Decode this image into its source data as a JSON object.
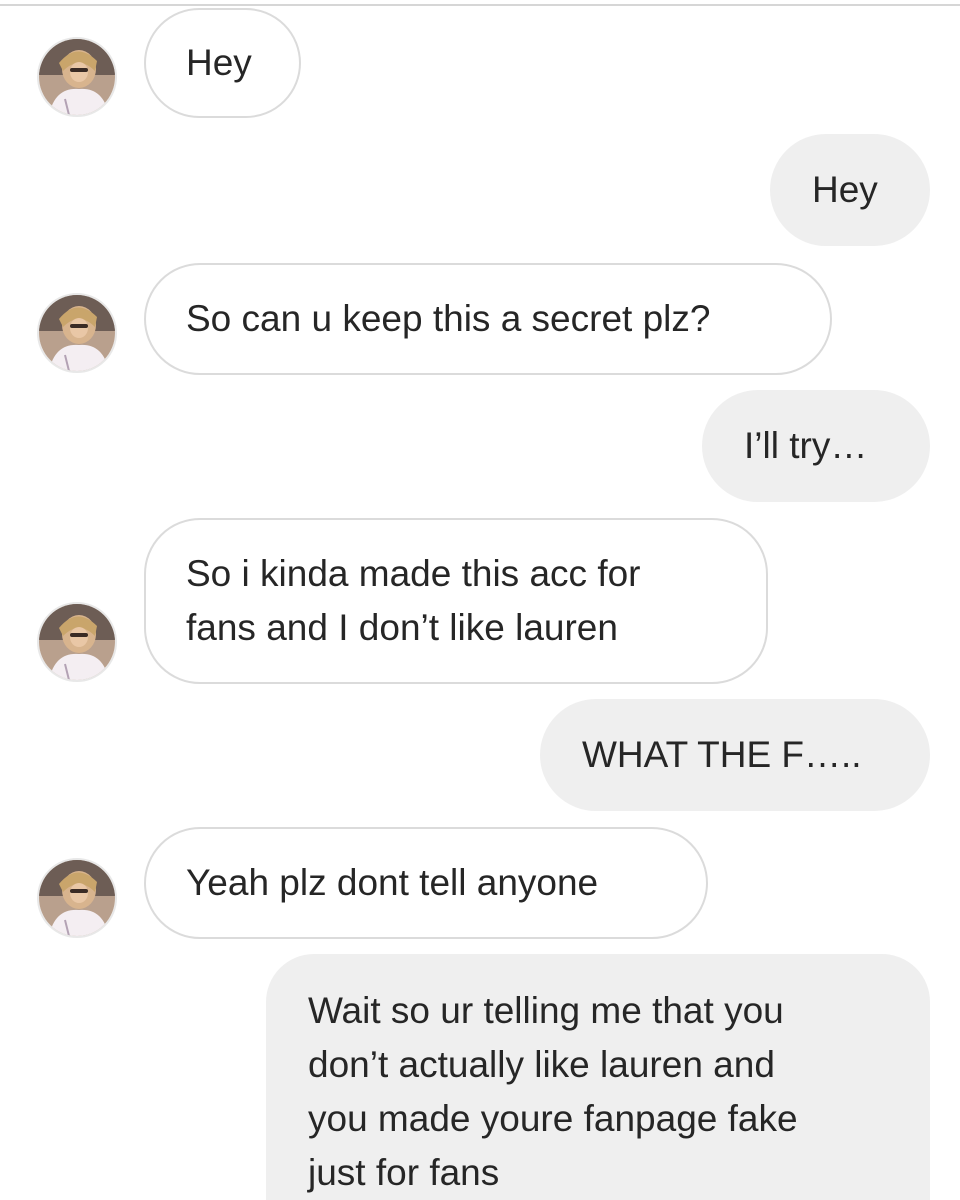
{
  "thread": {
    "messages": [
      {
        "sender": "them",
        "text": "Hey"
      },
      {
        "sender": "me",
        "text": "Hey"
      },
      {
        "sender": "them",
        "text": "So can u keep this a secret plz?"
      },
      {
        "sender": "me",
        "text": "I’ll try…"
      },
      {
        "sender": "them",
        "text": "So i kinda made this acc for\nfans and I don’t like lauren"
      },
      {
        "sender": "me",
        "text": "WHAT THE F….."
      },
      {
        "sender": "them",
        "text": "Yeah plz dont tell anyone"
      },
      {
        "sender": "me",
        "text": "Wait so ur telling me that you\ndon’t actually like lauren and\nyou made youre fanpage fake\njust for fans"
      }
    ]
  },
  "colors": {
    "incoming_bubble_bg": "#ffffff",
    "incoming_bubble_border": "#dbdbdb",
    "outgoing_bubble_bg": "#efefef",
    "text": "#262626"
  },
  "icons": {
    "avatar": "contact-avatar-photo"
  }
}
